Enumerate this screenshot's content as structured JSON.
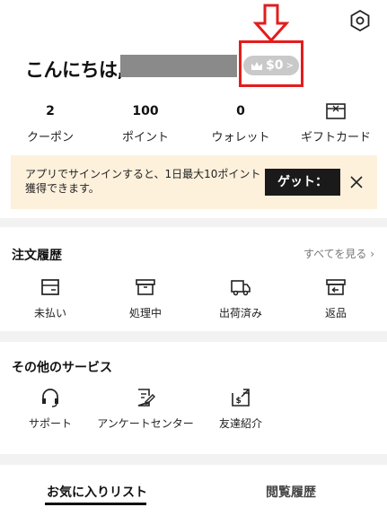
{
  "header": {
    "greeting": "こんにちは,",
    "level_value": "$0",
    "icons": {
      "settings": "gear-icon",
      "crown": "crown-icon",
      "annotation": "red-arrow-down"
    },
    "colors": {
      "annotation": "#e21d1d",
      "badge": "#c9c9c9"
    }
  },
  "stats": [
    {
      "value": "2",
      "label": "クーポン"
    },
    {
      "value": "100",
      "label": "ポイント"
    },
    {
      "value": "0",
      "label": "ウォレット"
    },
    {
      "value": "",
      "label": "ギフトカード",
      "icon": "gift-card-icon"
    }
  ],
  "banner": {
    "message": "アプリでサインインすると、1日最大10ポイント獲得できます。",
    "button": "ゲット：",
    "background": "#fdf1dc"
  },
  "orders": {
    "title": "注文履歴",
    "see_all": "すべてを見る ›",
    "items": [
      {
        "label": "未払い",
        "icon": "wallet-icon"
      },
      {
        "label": "処理中",
        "icon": "box-icon"
      },
      {
        "label": "出荷済み",
        "icon": "truck-icon"
      },
      {
        "label": "返品",
        "icon": "return-box-icon"
      }
    ]
  },
  "services": {
    "title": "その他のサービス",
    "items": [
      {
        "label": "サポート",
        "icon": "headset-icon"
      },
      {
        "label": "アンケートセンター",
        "icon": "survey-icon"
      },
      {
        "label": "友達紹介",
        "icon": "invite-icon"
      }
    ]
  },
  "tabs": {
    "favorites": "お気に入りリスト",
    "history": "閲覧履歴"
  }
}
